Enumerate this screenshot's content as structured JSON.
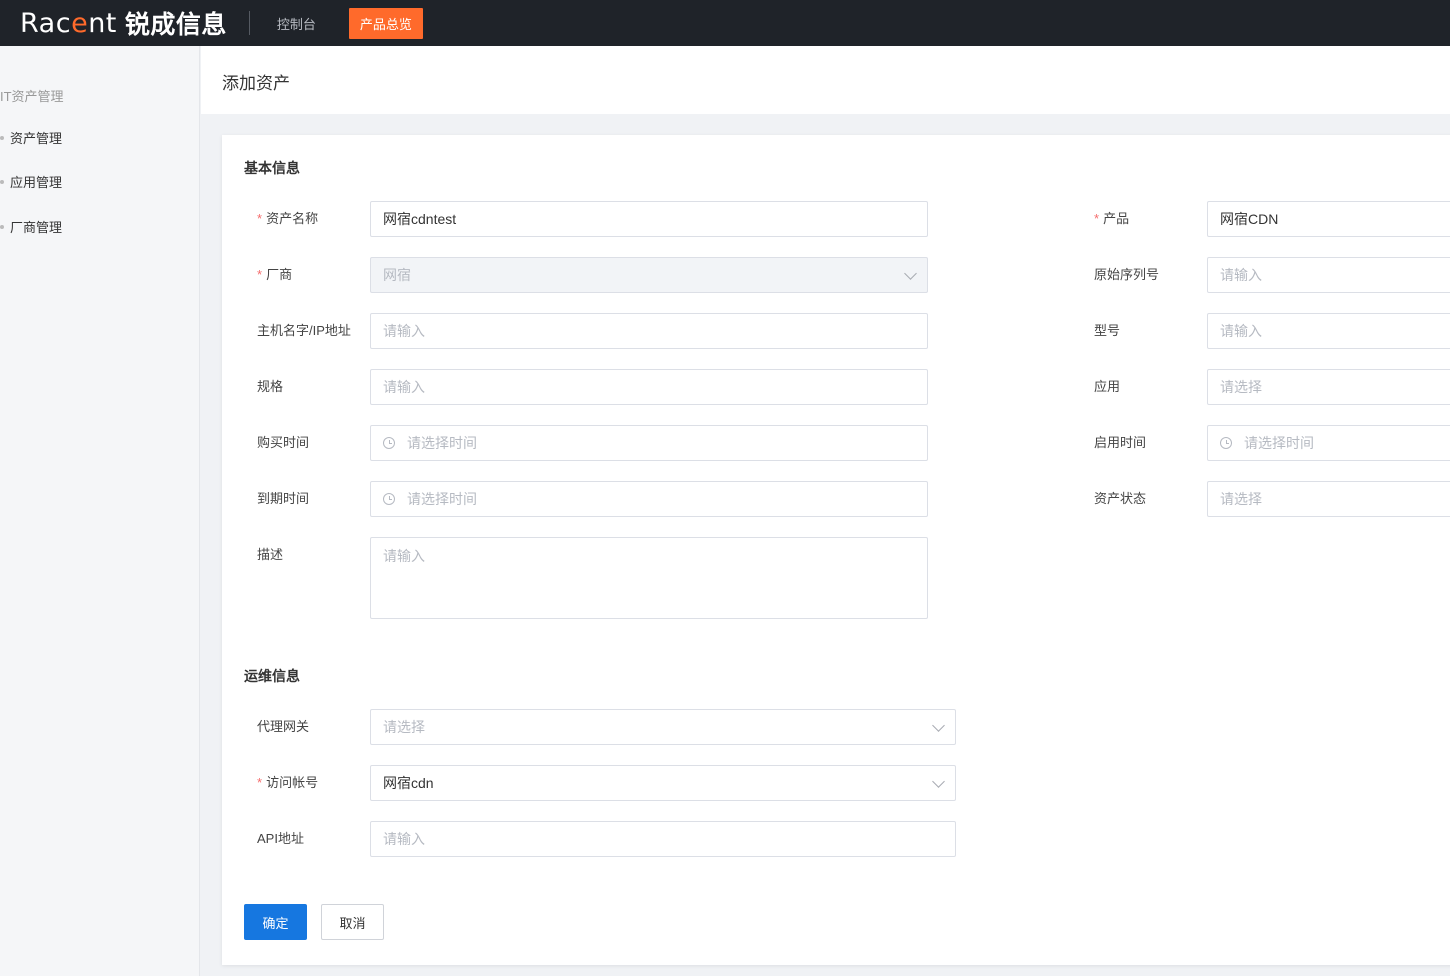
{
  "brand": {
    "latin_pre": "Rac",
    "latin_accent": "e",
    "latin_post": "nt",
    "cn": "锐成信息"
  },
  "topnav": {
    "items": [
      "控制台",
      "产品总览"
    ]
  },
  "sidebar": {
    "group": "IT资产管理",
    "items": [
      "资产管理",
      "应用管理",
      "厂商管理"
    ]
  },
  "page": {
    "title": "添加资产"
  },
  "basic": {
    "title": "基本信息",
    "asset_name": {
      "label": "资产名称",
      "value": "网宿cdntest"
    },
    "vendor": {
      "label": "厂商",
      "value": "网宿"
    },
    "host": {
      "label": "主机名字/IP地址",
      "placeholder": "请输入"
    },
    "spec": {
      "label": "规格",
      "placeholder": "请输入"
    },
    "purchase_time": {
      "label": "购买时间",
      "placeholder": "请选择时间"
    },
    "expire_time": {
      "label": "到期时间",
      "placeholder": "请选择时间"
    },
    "desc": {
      "label": "描述",
      "placeholder": "请输入"
    },
    "product": {
      "label": "产品",
      "value": "网宿CDN"
    },
    "serial": {
      "label": "原始序列号",
      "placeholder": "请输入"
    },
    "model": {
      "label": "型号",
      "placeholder": "请输入"
    },
    "app": {
      "label": "应用",
      "placeholder": "请选择"
    },
    "enable_time": {
      "label": "启用时间",
      "placeholder": "请选择时间"
    },
    "status": {
      "label": "资产状态",
      "placeholder": "请选择"
    }
  },
  "ops": {
    "title": "运维信息",
    "gateway": {
      "label": "代理网关",
      "placeholder": "请选择"
    },
    "account": {
      "label": "访问帐号",
      "value": "网宿cdn"
    },
    "api": {
      "label": "API地址",
      "placeholder": "请输入"
    }
  },
  "actions": {
    "confirm": "确定",
    "cancel": "取消"
  },
  "colors": {
    "accent": "#ff6a2b",
    "primary": "#1677e0",
    "topbar": "#1f2329",
    "required": "#f56c6c"
  }
}
